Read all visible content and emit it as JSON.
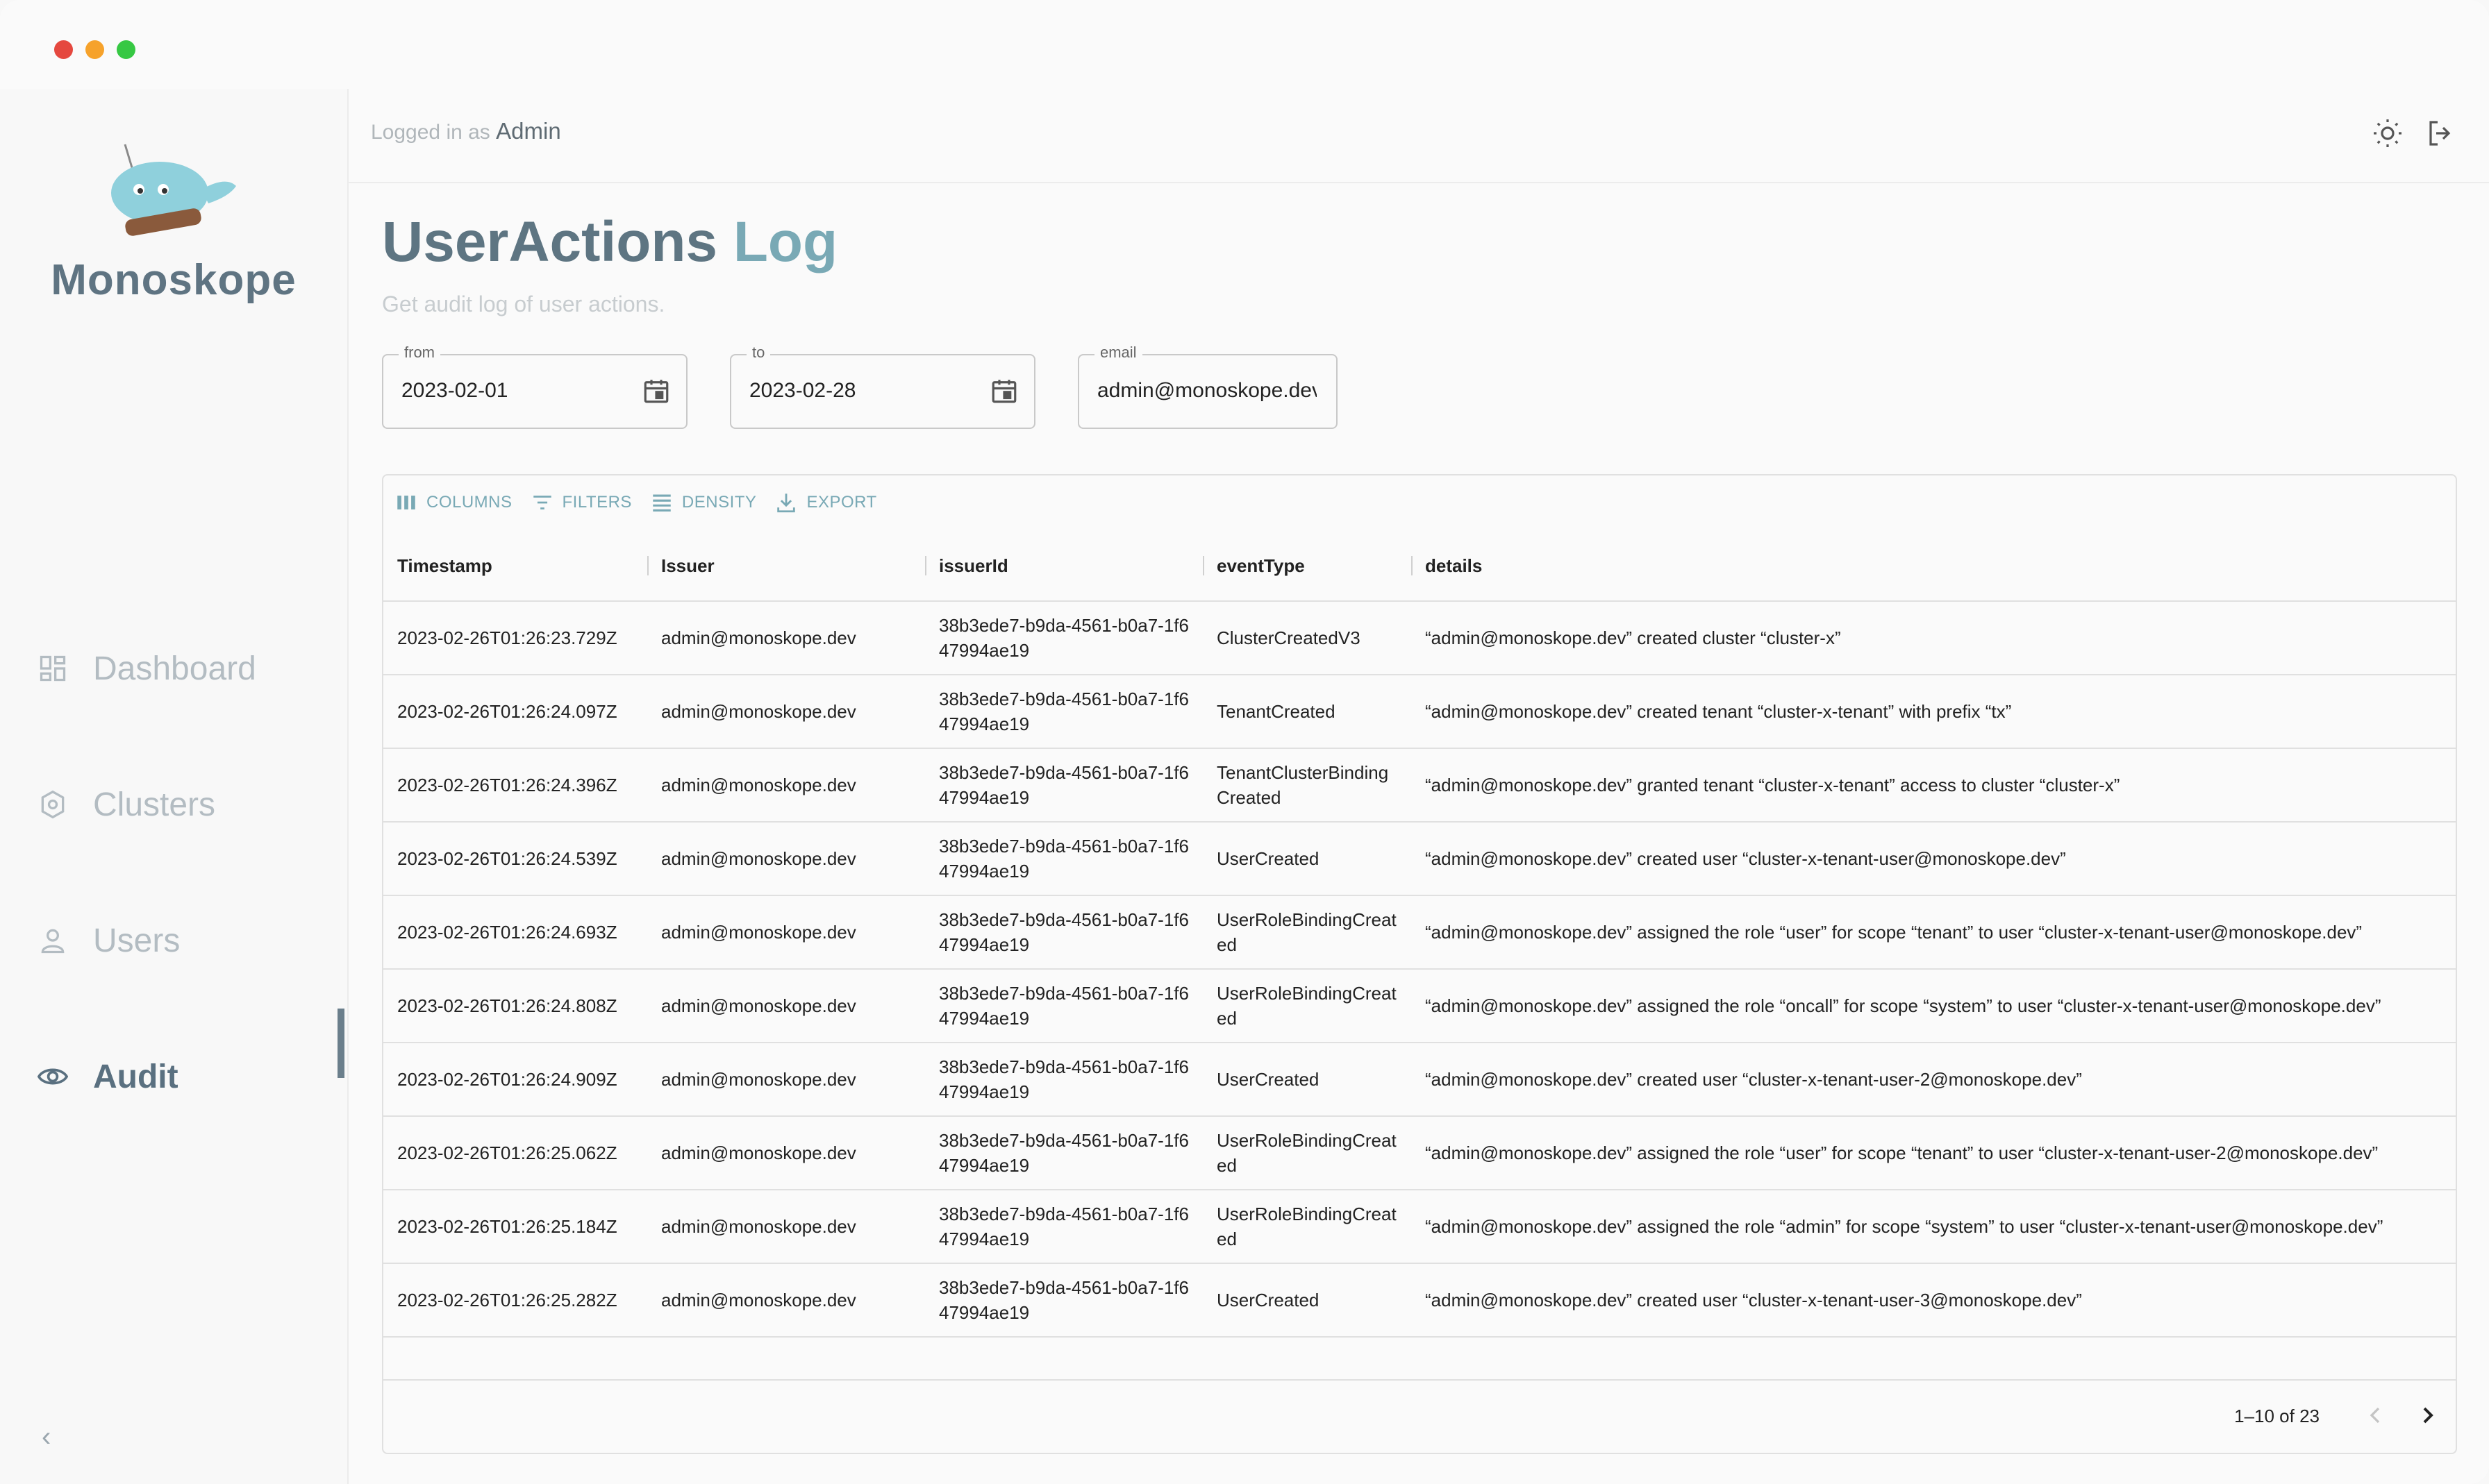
{
  "app": {
    "brand": "Monoskope"
  },
  "header": {
    "logged_prefix": "Logged in as",
    "user": "Admin"
  },
  "nav": {
    "items": [
      {
        "label": "Dashboard",
        "icon": "dashboard-icon"
      },
      {
        "label": "Clusters",
        "icon": "cluster-icon"
      },
      {
        "label": "Users",
        "icon": "user-icon"
      },
      {
        "label": "Audit",
        "icon": "eye-icon",
        "active": true
      }
    ],
    "collapse": "‹"
  },
  "page": {
    "title_main": "UserActions",
    "title_accent": "Log",
    "subtitle": "Get audit log of user actions."
  },
  "filters": {
    "from": {
      "label": "from",
      "value": "2023-02-01"
    },
    "to": {
      "label": "to",
      "value": "2023-02-28"
    },
    "email": {
      "label": "email",
      "value": "admin@monoskope.dev"
    }
  },
  "toolbar": {
    "columns": "COLUMNS",
    "filters": "FILTERS",
    "density": "DENSITY",
    "export": "EXPORT"
  },
  "table": {
    "columns": [
      "Timestamp",
      "Issuer",
      "issuerId",
      "eventType",
      "details"
    ],
    "rows": [
      [
        "2023-02-26T01:26:23.729Z",
        "admin@monoskope.dev",
        "38b3ede7-b9da-4561-b0a7-1f647994ae19",
        "ClusterCreatedV3",
        "“admin@monoskope.dev” created cluster “cluster-x”"
      ],
      [
        "2023-02-26T01:26:24.097Z",
        "admin@monoskope.dev",
        "38b3ede7-b9da-4561-b0a7-1f647994ae19",
        "TenantCreated",
        "“admin@monoskope.dev” created tenant “cluster-x-tenant” with prefix “tx”"
      ],
      [
        "2023-02-26T01:26:24.396Z",
        "admin@monoskope.dev",
        "38b3ede7-b9da-4561-b0a7-1f647994ae19",
        "TenantClusterBinding Created",
        "“admin@monoskope.dev” granted tenant “cluster-x-tenant” access to cluster “cluster-x”"
      ],
      [
        "2023-02-26T01:26:24.539Z",
        "admin@monoskope.dev",
        "38b3ede7-b9da-4561-b0a7-1f647994ae19",
        "UserCreated",
        "“admin@monoskope.dev” created user “cluster-x-tenant-user@monoskope.dev”"
      ],
      [
        "2023-02-26T01:26:24.693Z",
        "admin@monoskope.dev",
        "38b3ede7-b9da-4561-b0a7-1f647994ae19",
        "UserRoleBindingCreated",
        "“admin@monoskope.dev” assigned the role “user” for scope “tenant” to user “cluster-x-tenant-user@monoskope.dev”"
      ],
      [
        "2023-02-26T01:26:24.808Z",
        "admin@monoskope.dev",
        "38b3ede7-b9da-4561-b0a7-1f647994ae19",
        "UserRoleBindingCreated",
        "“admin@monoskope.dev” assigned the role “oncall” for scope “system” to user “cluster-x-tenant-user@monoskope.dev”"
      ],
      [
        "2023-02-26T01:26:24.909Z",
        "admin@monoskope.dev",
        "38b3ede7-b9da-4561-b0a7-1f647994ae19",
        "UserCreated",
        "“admin@monoskope.dev” created user “cluster-x-tenant-user-2@monoskope.dev”"
      ],
      [
        "2023-02-26T01:26:25.062Z",
        "admin@monoskope.dev",
        "38b3ede7-b9da-4561-b0a7-1f647994ae19",
        "UserRoleBindingCreated",
        "“admin@monoskope.dev” assigned the role “user” for scope “tenant” to user “cluster-x-tenant-user-2@monoskope.dev”"
      ],
      [
        "2023-02-26T01:26:25.184Z",
        "admin@monoskope.dev",
        "38b3ede7-b9da-4561-b0a7-1f647994ae19",
        "UserRoleBindingCreated",
        "“admin@monoskope.dev” assigned the role “admin” for scope “system” to user “cluster-x-tenant-user@monoskope.dev”"
      ],
      [
        "2023-02-26T01:26:25.282Z",
        "admin@monoskope.dev",
        "38b3ede7-b9da-4561-b0a7-1f647994ae19",
        "UserCreated",
        "“admin@monoskope.dev” created user “cluster-x-tenant-user-3@monoskope.dev”"
      ]
    ]
  },
  "pagination": {
    "text": "1–10 of 23"
  },
  "colors": {
    "accent": "#79a9b5",
    "title": "#5e7582",
    "nav_muted": "#b3bcc2"
  }
}
